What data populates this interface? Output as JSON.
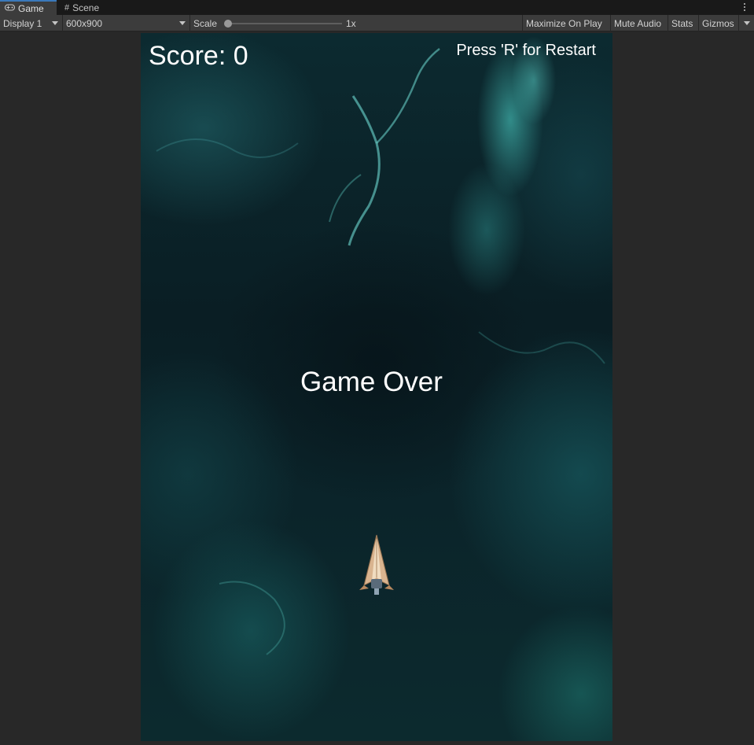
{
  "tabs": [
    {
      "label": "Game",
      "icon": "gamepad-icon",
      "active": true
    },
    {
      "label": "Scene",
      "icon": "grid-icon",
      "active": false
    }
  ],
  "toolbar": {
    "display": "Display 1",
    "resolution": "600x900",
    "scale_label": "Scale",
    "scale_value": "1x",
    "maximize_on_play": "Maximize On Play",
    "mute_audio": "Mute Audio",
    "stats": "Stats",
    "gizmos": "Gizmos"
  },
  "game": {
    "score_text": "Score: 0",
    "restart_hint": "Press 'R' for Restart",
    "game_over_text": "Game Over"
  },
  "colors": {
    "accent": "#3a79bb",
    "hud_text": "#ffffff",
    "nebula": "#1b6f72"
  }
}
